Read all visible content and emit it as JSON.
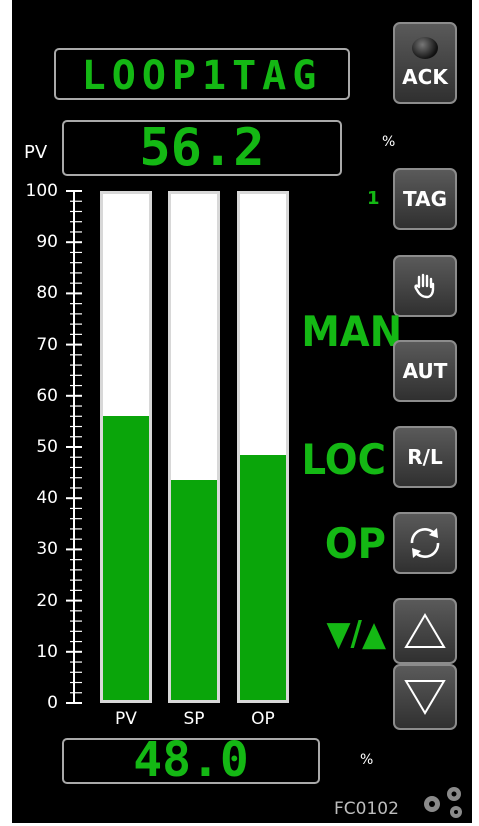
{
  "faceplate": {
    "tag_name": "LOOP1TAG",
    "pv_label": "PV",
    "pv_value": "56.2",
    "pv_unit": "%",
    "output_value": "48.0",
    "output_unit": "%",
    "tag_count": "1",
    "footer_id": "FC0102",
    "mode_state": "MAN",
    "control_state": "LOC",
    "output_state": "OP",
    "ramp_symbol": "▼/▲"
  },
  "buttons": {
    "ack": "ACK",
    "tag": "TAG",
    "auto": "AUT",
    "remote_local": "R/L"
  },
  "scale": {
    "ticks": [
      "100",
      "90",
      "80",
      "70",
      "60",
      "50",
      "40",
      "30",
      "20",
      "10",
      "0"
    ]
  },
  "bars": [
    {
      "name": "PV",
      "value": 56.2
    },
    {
      "name": "SP",
      "value": 43.5
    },
    {
      "name": "OP",
      "value": 48.5
    }
  ],
  "colors": {
    "accent": "#14b814",
    "bar_fill": "#0aa50a",
    "panel": "#000000"
  },
  "icons": [
    "hand-icon",
    "cycle-icon",
    "up-arrow-icon",
    "down-arrow-icon",
    "gear-icon",
    "alarm-lamp-icon"
  ]
}
